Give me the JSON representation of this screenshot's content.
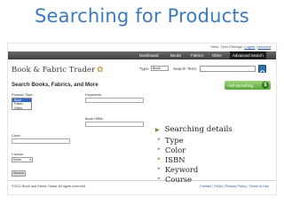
{
  "slide": {
    "title": "Searching for Products",
    "bullets": [
      {
        "text": "Searching details",
        "children": [
          "Type",
          "Color",
          "ISBN",
          "Keyword",
          "Course"
        ]
      }
    ]
  },
  "screenshot": {
    "userbar": {
      "greeting": "Hello, Tyler Ethridge:",
      "links": [
        "Logout",
        "Account"
      ],
      "separator": "|"
    },
    "nav": {
      "tabs": [
        {
          "label": "Dashboard",
          "active": false
        },
        {
          "label": "Books",
          "active": false
        },
        {
          "label": "Fabrics",
          "active": false
        },
        {
          "label": "Other",
          "active": false
        },
        {
          "label": "Advanced Search",
          "active": true
        }
      ]
    },
    "brand": {
      "name": "Book & Fabric Trader"
    },
    "quick_search": {
      "type_label": "Type:",
      "type_value": "Book",
      "term_label": "Search Term:",
      "term_value": ""
    },
    "section_title": "Search Books, Fabrics, and More",
    "sell_button": {
      "label": "Sell Something",
      "icon": "$"
    },
    "form": {
      "product_type_label": "Product Type:",
      "product_types": [
        {
          "label": "Book",
          "selected": true
        },
        {
          "label": "Fabric",
          "selected": false
        },
        {
          "label": "Other",
          "selected": false
        }
      ],
      "keywords_label": "Keywords:",
      "isbn_label": "Book ISBN:",
      "color_label": "Color:",
      "course_label": "Course:",
      "course_value": "None",
      "search_label": "Search"
    },
    "footer": {
      "copyright": "©2011 Book and Fabric Trader All rights reserved.",
      "links": [
        "Contact",
        "FAQs",
        "Privacy Policy",
        "Terms of Use"
      ],
      "separator": "|"
    }
  },
  "colors": {
    "title": "#3a7abf",
    "bullet_arrow": "#6b8e23",
    "nav_bg": "#3c3c3c",
    "sell_button": "#57a83a",
    "selection": "#3366cc"
  }
}
